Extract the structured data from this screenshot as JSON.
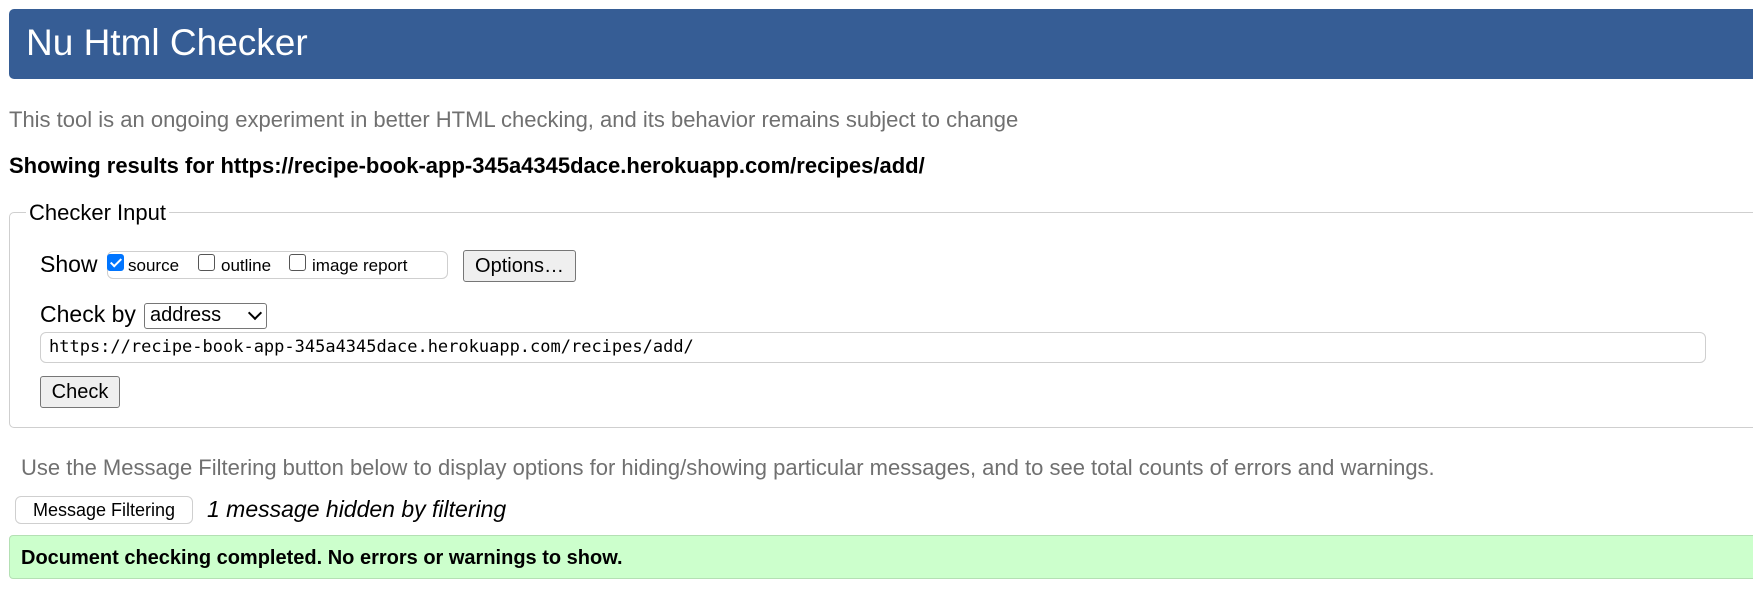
{
  "header": {
    "title": "Nu Html Checker"
  },
  "intro": "This tool is an ongoing experiment in better HTML checking, and its behavior remains subject to change",
  "results_heading": "Showing results for https://recipe-book-app-345a4345dace.herokuapp.com/recipes/add/",
  "checker_input": {
    "legend": "Checker Input",
    "show_label": "Show",
    "show_options": [
      {
        "label": "source",
        "checked": true
      },
      {
        "label": "outline",
        "checked": false
      },
      {
        "label": "image report",
        "checked": false
      }
    ],
    "options_button": "Options…",
    "check_by_label": "Check by",
    "check_by_selected": "address",
    "url_value": "https://recipe-book-app-345a4345dace.herokuapp.com/recipes/add/",
    "check_button": "Check"
  },
  "filtering": {
    "note": "Use the Message Filtering button below to display options for hiding/showing particular messages, and to see total counts of errors and warnings.",
    "button": "Message Filtering",
    "hidden_note": "1 message hidden by filtering"
  },
  "status": {
    "message": "Document checking completed. No errors or warnings to show."
  },
  "colors": {
    "header_bg": "#365d95",
    "success_bg": "#ccffcc",
    "checkbox_accent": "#0075ff"
  }
}
